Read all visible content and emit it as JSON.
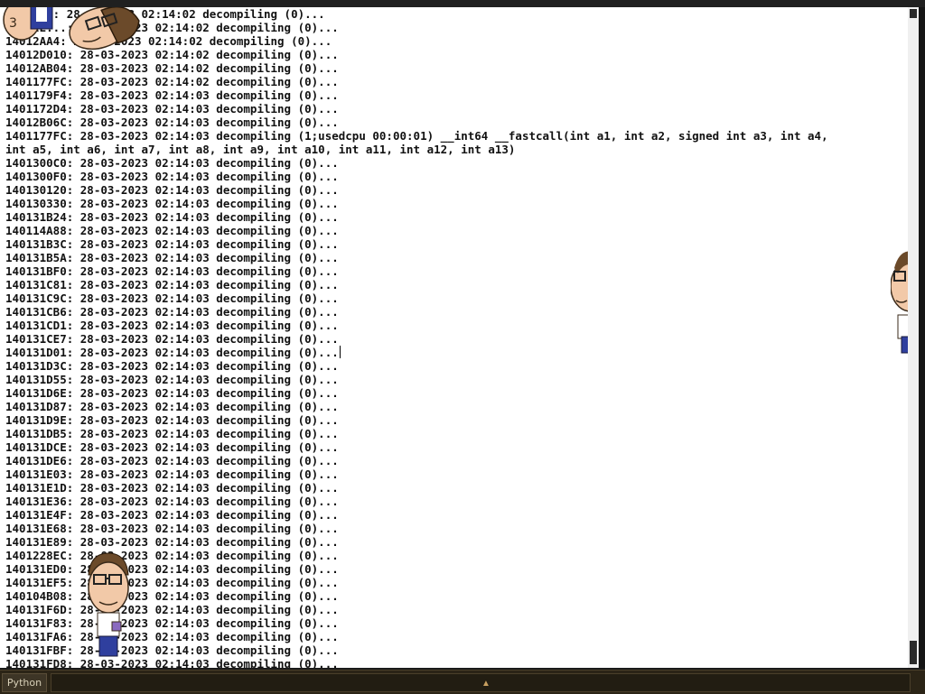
{
  "colors": {
    "output_bg": "#ffffff",
    "text": "#111111",
    "taskbar_bg": "#2b2416",
    "taskbar_text": "#d8d0b8"
  },
  "log": {
    "lines": [
      "1401...: 28-03-2023 02:14:02 decompiling (0)...",
      "14012E...: 28-03-2023 02:14:02 decompiling (0)...",
      "14012AA4: 28-03-2023 02:14:02 decompiling (0)...",
      "14012D010: 28-03-2023 02:14:02 decompiling (0)...",
      "14012AB04: 28-03-2023 02:14:02 decompiling (0)...",
      "1401177FC: 28-03-2023 02:14:02 decompiling (0)...",
      "1401179F4: 28-03-2023 02:14:03 decompiling (0)...",
      "1401172D4: 28-03-2023 02:14:03 decompiling (0)...",
      "14012B06C: 28-03-2023 02:14:03 decompiling (0)...",
      "1401177FC: 28-03-2023 02:14:03 decompiling (1;usedcpu 00:00:01) __int64 __fastcall(int a1, int a2, signed int a3, int a4,",
      "int a5, int a6, int a7, int a8, int a9, int a10, int a11, int a12, int a13)",
      "1401300C0: 28-03-2023 02:14:03 decompiling (0)...",
      "1401300F0: 28-03-2023 02:14:03 decompiling (0)...",
      "140130120: 28-03-2023 02:14:03 decompiling (0)...",
      "140130330: 28-03-2023 02:14:03 decompiling (0)...",
      "140131B24: 28-03-2023 02:14:03 decompiling (0)...",
      "140114A88: 28-03-2023 02:14:03 decompiling (0)...",
      "140131B3C: 28-03-2023 02:14:03 decompiling (0)...",
      "140131B5A: 28-03-2023 02:14:03 decompiling (0)...",
      "140131BF0: 28-03-2023 02:14:03 decompiling (0)...",
      "140131C81: 28-03-2023 02:14:03 decompiling (0)...",
      "140131C9C: 28-03-2023 02:14:03 decompiling (0)...",
      "140131CB6: 28-03-2023 02:14:03 decompiling (0)...",
      "140131CD1: 28-03-2023 02:14:03 decompiling (0)...",
      "140131CE7: 28-03-2023 02:14:03 decompiling (0)...",
      "140131D01: 28-03-2023 02:14:03 decompiling (0)...",
      "140131D3C: 28-03-2023 02:14:03 decompiling (0)...",
      "140131D55: 28-03-2023 02:14:03 decompiling (0)...",
      "140131D6E: 28-03-2023 02:14:03 decompiling (0)...",
      "140131D87: 28-03-2023 02:14:03 decompiling (0)...",
      "140131D9E: 28-03-2023 02:14:03 decompiling (0)...",
      "140131DB5: 28-03-2023 02:14:03 decompiling (0)...",
      "140131DCE: 28-03-2023 02:14:03 decompiling (0)...",
      "140131DE6: 28-03-2023 02:14:03 decompiling (0)...",
      "140131E03: 28-03-2023 02:14:03 decompiling (0)...",
      "140131E1D: 28-03-2023 02:14:03 decompiling (0)...",
      "140131E36: 28-03-2023 02:14:03 decompiling (0)...",
      "140131E4F: 28-03-2023 02:14:03 decompiling (0)...",
      "140131E68: 28-03-2023 02:14:03 decompiling (0)...",
      "140131E89: 28-03-2023 02:14:03 decompiling (0)...",
      "1401228EC: 28-03-2023 02:14:03 decompiling (0)...",
      "140131ED0: 28-03-2023 02:14:03 decompiling (0)...",
      "140131EF5: 28-03-2023 02:14:03 decompiling (0)...",
      "140104B08: 28-03-2023 02:14:03 decompiling (0)...",
      "140131F6D: 28-03-2023 02:14:03 decompiling (0)...",
      "140131F83: 28-03-2023 02:14:03 decompiling (0)...",
      "140131FA6: 28-03-2023 02:14:03 decompiling (0)...",
      "140131FBF: 28-03-2023 02:14:03 decompiling (0)...",
      "140131FD8: 28-03-2023 02:14:03 decompiling (0)..."
    ],
    "caret_line_index": 25
  },
  "taskbar": {
    "button_label": "Python"
  }
}
